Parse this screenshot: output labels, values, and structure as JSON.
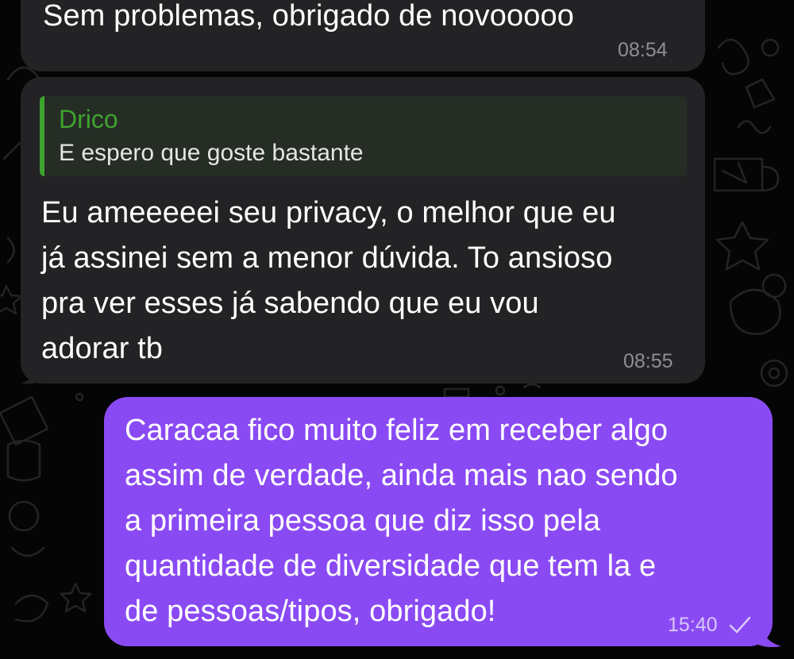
{
  "theme": {
    "incoming_bubble_color": "#232326",
    "outgoing_bubble_color": "#8a4af3",
    "reply_accent_color": "#3fa32f",
    "background_color": "#050505"
  },
  "messages": [
    {
      "direction": "incoming",
      "text": "Sem problemas, obrigado de novooooo",
      "time": "08:54"
    },
    {
      "direction": "incoming",
      "reply_to": {
        "name": "Drico",
        "text": "E espero que goste bastante"
      },
      "text": "Eu ameeeeei seu privacy, o melhor que eu\njá assinei sem a menor dúvida. To ansioso\npra ver esses já sabendo que eu vou\nadorar tb",
      "time": "08:55"
    },
    {
      "direction": "outgoing",
      "text": "Caracaa fico muito feliz em receber algo\nassim de verdade, ainda mais nao sendo\na primeira pessoa que diz isso pela\nquantidade de diversidade que tem la e\nde pessoas/tipos, obrigado!",
      "time": "15:40",
      "status_icon": "single-check-icon"
    }
  ]
}
